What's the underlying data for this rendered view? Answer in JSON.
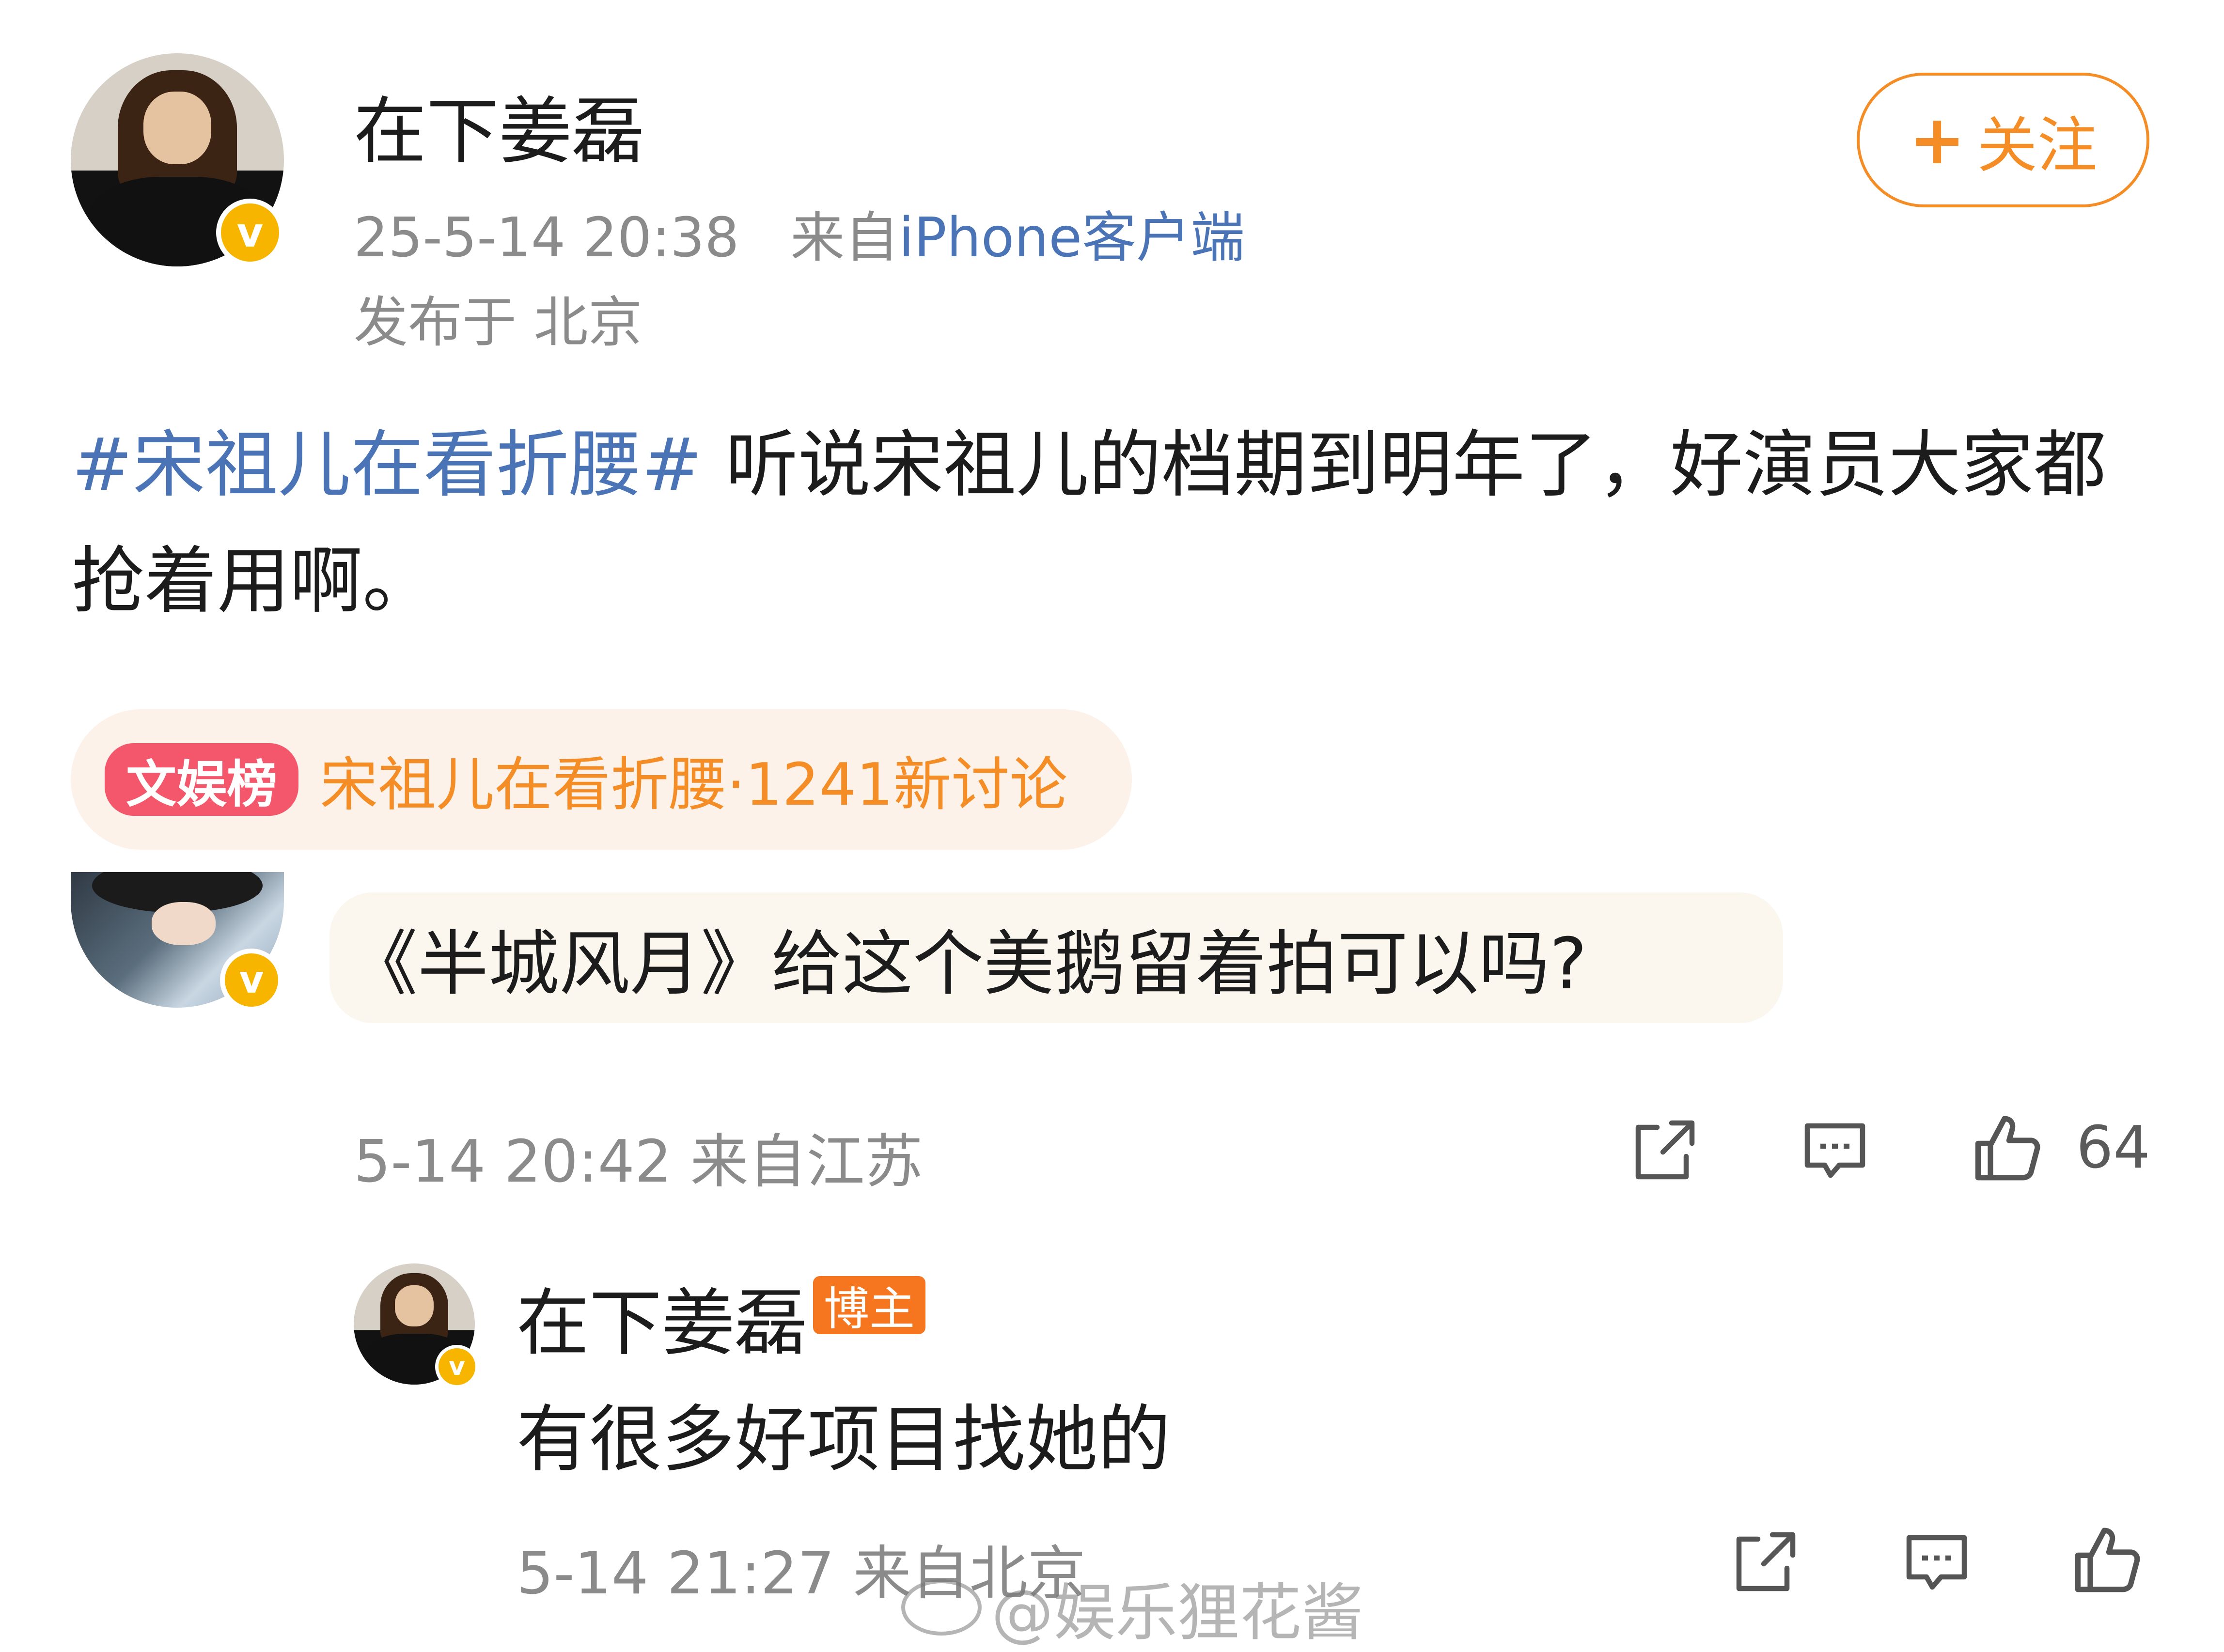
{
  "post": {
    "author_name": "在下姜磊",
    "timestamp": "25-5-14 20:38",
    "source_prefix": "来自",
    "source_app": "iPhone客户端",
    "location": "发布于 北京",
    "follow_label": "关注",
    "hashtag": "#宋祖儿在看折腰#",
    "text": " 听说宋祖儿的档期到明年了，好演员大家都抢着用啊。"
  },
  "trend": {
    "badge": "文娱榜",
    "text": "宋祖儿在看折腰·1241新讨论"
  },
  "comment": {
    "text": "《半城风月》给这个美鹅留着拍可以吗?",
    "meta": "5-14 20:42 来自江苏",
    "like_count": "64"
  },
  "reply": {
    "name": "在下姜磊",
    "host_badge": "博主",
    "text": "有很多好项目找她的",
    "meta": "5-14 21:27 来自北京"
  },
  "watermark": "@娱乐狸花酱",
  "icons": {
    "share": "share-icon",
    "comment": "comment-icon",
    "like": "thumbs-up-icon",
    "verified": "verified-badge-icon"
  },
  "colors": {
    "accent_orange": "#f58d26",
    "link_blue": "#4a74b6",
    "trend_badge": "#f4576b",
    "verified": "#f7b500"
  }
}
